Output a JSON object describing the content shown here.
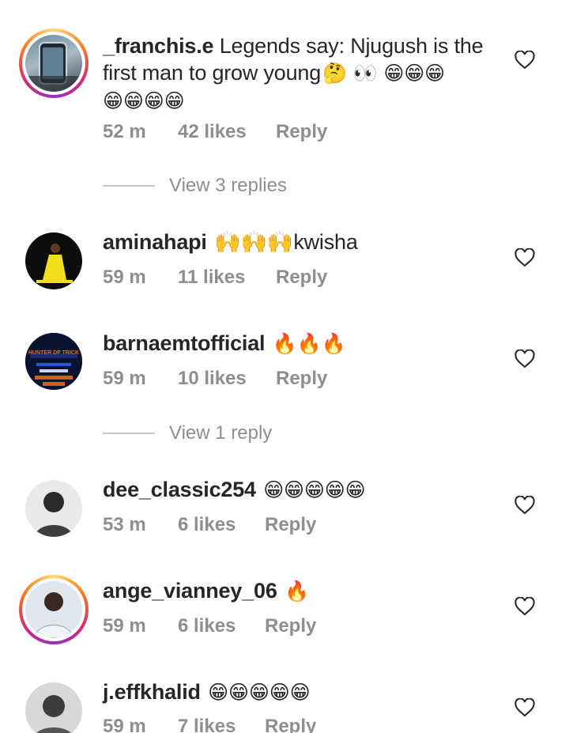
{
  "comments": [
    {
      "username": "_franchis.e",
      "text_line1": "Legends say: Njugush is the",
      "text_line2": "first man to grow young",
      "emoji_line2": "🤔 👀 😁😁😁",
      "emoji_line3": "😁😁😁😁",
      "time": "52 m",
      "likes": "42 likes",
      "reply": "Reply",
      "view_replies": "View 3 replies",
      "avatar_icon": "phone-photo-avatar"
    },
    {
      "username": "aminahapi",
      "text": "🙌🙌🙌kwisha",
      "time": "59 m",
      "likes": "11 likes",
      "reply": "Reply",
      "avatar_icon": "yellow-dress-avatar"
    },
    {
      "username": "barnaemtofficial",
      "text": "🔥🔥🔥",
      "time": "59 m",
      "likes": "10 likes",
      "reply": "Reply",
      "view_replies": "View 1 reply",
      "avatar_icon": "hunter-dp-trick-logo",
      "avatar_text": "HUNTER DP TRICK"
    },
    {
      "username": "dee_classic254",
      "text": "😁😁😁😁😁",
      "time": "53 m",
      "likes": "6 likes",
      "reply": "Reply",
      "avatar_icon": "person-avatar"
    },
    {
      "username": "ange_vianney_06",
      "text": "🔥",
      "time": "59 m",
      "likes": "6 likes",
      "reply": "Reply",
      "avatar_icon": "person-avatar"
    },
    {
      "username": "j.effkhalid",
      "text": "😁😁😁😁😁",
      "time": "59 m",
      "likes": "7 likes",
      "reply": "Reply",
      "avatar_icon": "person-avatar"
    }
  ],
  "colors": {
    "text": "#262626",
    "meta": "#8e8e8e",
    "rule": "#c7c7c7"
  }
}
